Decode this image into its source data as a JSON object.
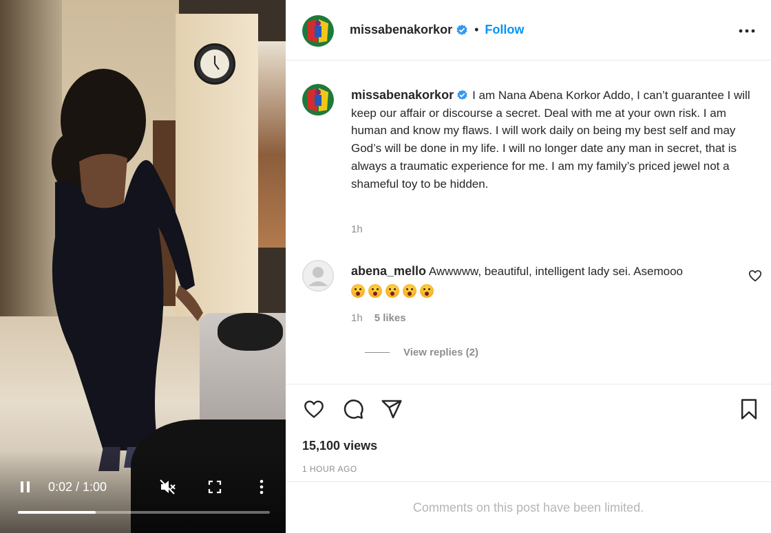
{
  "account": {
    "username": "missabenakorkor",
    "follow_label": "Follow",
    "separator": "•"
  },
  "caption": {
    "text": "I am Nana Abena Korkor Addo, I can’t guarantee I will keep our affair or discourse a secret. Deal with me at your own risk. I am human and know my flaws. I will work daily on being my best self and may God’s will be done in my life. I will no longer date any man in secret, that is always a traumatic experience for me. I am my family’s priced jewel not a shameful toy to be hidden.",
    "time": "1h"
  },
  "comment": {
    "username": "abena_mello",
    "text": "Awwwww, beautiful, intelligent lady sei. Asemooo",
    "emoji_count": 5,
    "time": "1h",
    "likes": "5 likes",
    "view_replies": "View replies (2)"
  },
  "video": {
    "time_display": "0:02 / 1:00",
    "progress_fraction": 0.31,
    "state": "playing",
    "muted": true
  },
  "post": {
    "views": "15,100 views",
    "posted_ago": "1 HOUR AGO",
    "comments_notice": "Comments on this post have been limited."
  },
  "icons": {
    "verified": "verified-badge-icon",
    "more": "more-options-icon",
    "like": "heart-icon",
    "comment": "comment-icon",
    "share": "share-icon",
    "save": "bookmark-icon",
    "pause": "pause-icon",
    "mute": "muted-speaker-icon",
    "fullscreen": "fullscreen-icon",
    "menu": "vertical-dots-icon"
  },
  "colors": {
    "link": "#0095f6",
    "verified": "#3897f0",
    "muted_text": "#8e8e8e"
  }
}
